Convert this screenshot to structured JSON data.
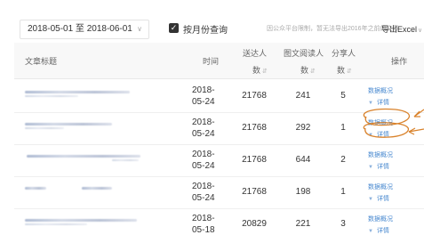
{
  "toolbar": {
    "date_range": "2018-05-01 至 2018-06-01",
    "month_query_label": "按月份查询",
    "note": "因公众平台限制，暂无法导出2016年之前的文章",
    "export_label": "导出Excel"
  },
  "table": {
    "headers": {
      "title": "文章标题",
      "time": "时间",
      "reach_line1": "送达人",
      "reach_line2": "数",
      "reads_line1": "图文阅读人",
      "reads_line2": "数",
      "shares_line1": "分享人",
      "shares_line2": "数",
      "ops": "操作"
    },
    "rows": [
      {
        "date_top": "2018-",
        "date_bottom": "05-24",
        "reach": "21768",
        "reads": "241",
        "shares": "5",
        "link1": "数据概况",
        "link2": "详情"
      },
      {
        "date_top": "2018-",
        "date_bottom": "05-24",
        "reach": "21768",
        "reads": "292",
        "shares": "1",
        "link1": "数据概况",
        "link2": "详情"
      },
      {
        "date_top": "2018-",
        "date_bottom": "05-24",
        "reach": "21768",
        "reads": "644",
        "shares": "2",
        "link1": "数据概况",
        "link2": "详情"
      },
      {
        "date_top": "2018-",
        "date_bottom": "05-24",
        "reach": "21768",
        "reads": "198",
        "shares": "1",
        "link1": "数据概况",
        "link2": "详情"
      },
      {
        "date_top": "2018-",
        "date_bottom": "05-18",
        "reach": "20829",
        "reads": "221",
        "shares": "3",
        "link1": "数据概况",
        "link2": "详情"
      }
    ]
  },
  "colors": {
    "link": "#4a8ad0",
    "annotation": "#d9822b",
    "header_bg": "#f8f8f8"
  }
}
